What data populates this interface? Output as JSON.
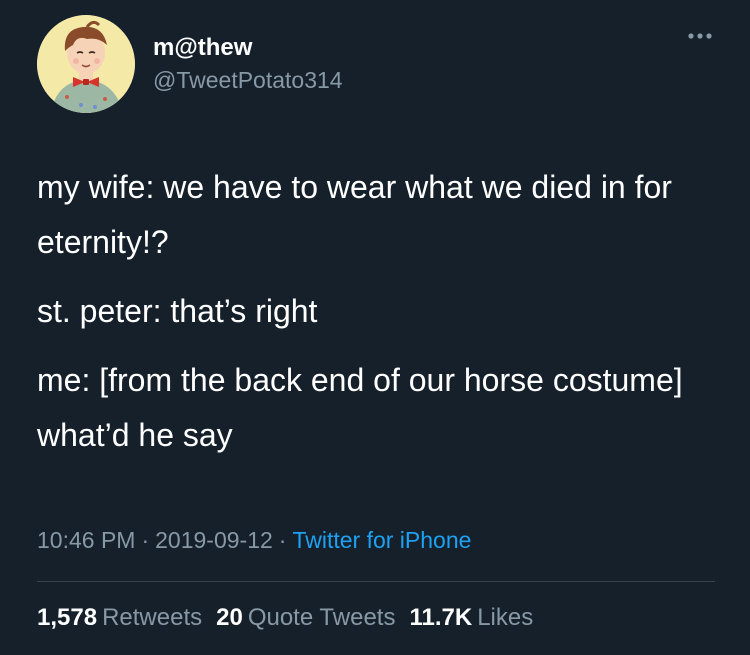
{
  "tweet": {
    "user": {
      "display_name": "m@thew",
      "handle": "@TweetPotato314",
      "avatar_icon": "cartoon-boy-bowtie-avatar"
    },
    "more_icon": "ellipsis-icon",
    "paragraphs": [
      "my wife: we have to wear what we died in for eternity!?",
      "st. peter: that’s right",
      "me: [from the back end of our horse costume]  what’d he say"
    ],
    "meta": {
      "time": "10:46 PM",
      "date": "2019-09-12",
      "separator": "·",
      "source": "Twitter for iPhone"
    },
    "stats": {
      "retweets_count": "1,578",
      "retweets_label": "Retweets",
      "quotes_count": "20",
      "quotes_label": "Quote Tweets",
      "likes_count": "11.7K",
      "likes_label": "Likes"
    }
  },
  "colors": {
    "background": "#15202b",
    "primary_text": "#ffffff",
    "secondary_text": "#8899a6",
    "link": "#1da1f2",
    "divider": "#38444d",
    "avatar_background": "#f4e9a6"
  }
}
